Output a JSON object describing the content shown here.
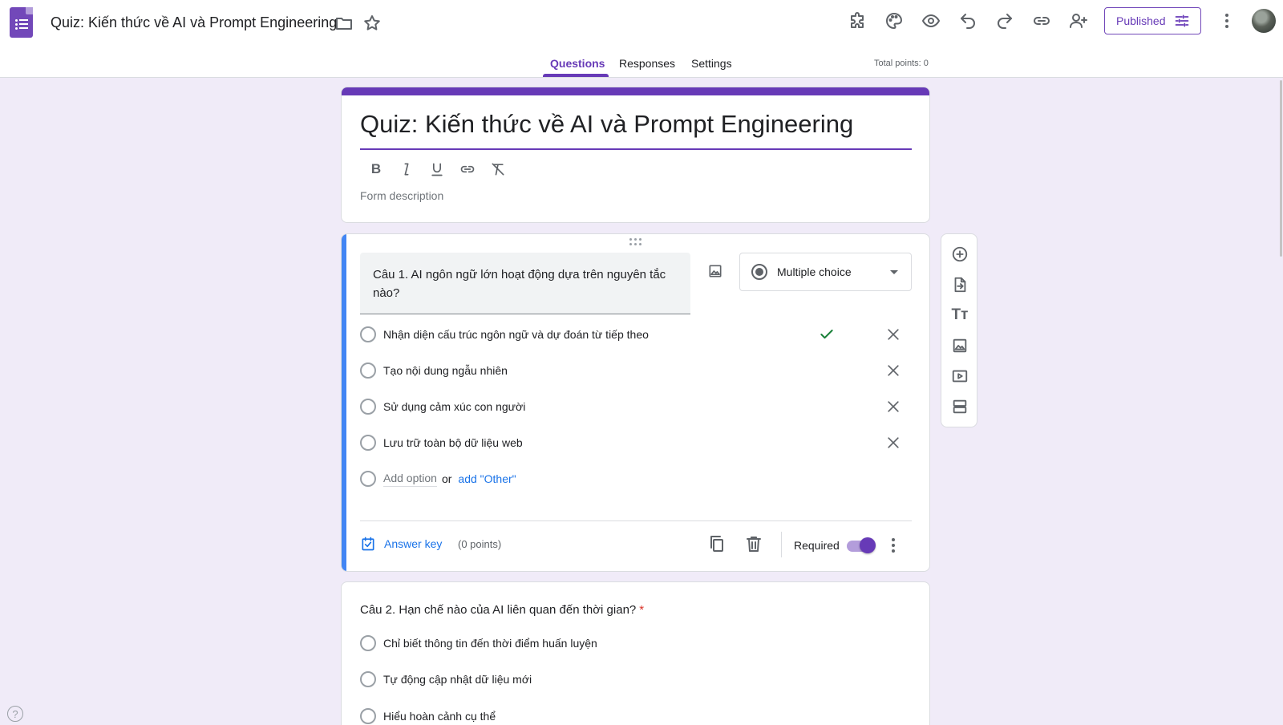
{
  "header": {
    "title": "Quiz: Kiến thức về AI và Prompt Engineering",
    "published_label": "Published",
    "icons": [
      "folder-icon",
      "star-icon",
      "addons-icon",
      "palette-icon",
      "preview-icon",
      "undo-icon",
      "redo-icon",
      "link-icon",
      "add-collaborator-icon",
      "settings-sliders-icon",
      "more-vert-icon"
    ]
  },
  "tabs": [
    {
      "label": "Questions",
      "active": true
    },
    {
      "label": "Responses",
      "active": false
    },
    {
      "label": "Settings",
      "active": false
    }
  ],
  "total_points": "Total points: 0",
  "form": {
    "title": "Quiz: Kiến thức về AI và Prompt Engineering",
    "description_placeholder": "Form description"
  },
  "question1": {
    "text": "Câu 1. AI ngôn ngữ lớn hoạt động dựa trên nguyên tắc nào?",
    "type": "Multiple choice",
    "options": [
      {
        "label": "Nhận diện cấu trúc ngôn ngữ và dự đoán từ tiếp theo",
        "correct": true
      },
      {
        "label": "Tạo nội dung ngẫu nhiên",
        "correct": false
      },
      {
        "label": "Sử dụng cảm xúc con người",
        "correct": false
      },
      {
        "label": "Lưu trữ toàn bộ dữ liệu web",
        "correct": false
      }
    ],
    "add_option": "Add option",
    "or": "or",
    "add_other": "add \"Other\"",
    "answer_key": "Answer key",
    "points": "(0 points)",
    "required_label": "Required",
    "required": true
  },
  "question2": {
    "text": "Câu 2. Hạn chế nào của AI liên quan đến thời gian?",
    "required_mark": "*",
    "options": [
      {
        "label": "Chỉ biết thông tin đến thời điểm huấn luyện"
      },
      {
        "label": "Tự động cập nhật dữ liệu mới"
      },
      {
        "label": "Hiểu hoàn cảnh cụ thể"
      }
    ]
  },
  "side_toolbar": [
    "add-question-icon",
    "import-questions-icon",
    "add-title-icon",
    "add-image-icon",
    "add-video-icon",
    "add-section-icon"
  ],
  "help": "?",
  "colors": {
    "accent": "#673ab7",
    "active_card": "#4285f4",
    "background": "#f0ebf8",
    "link": "#1a73e8"
  }
}
